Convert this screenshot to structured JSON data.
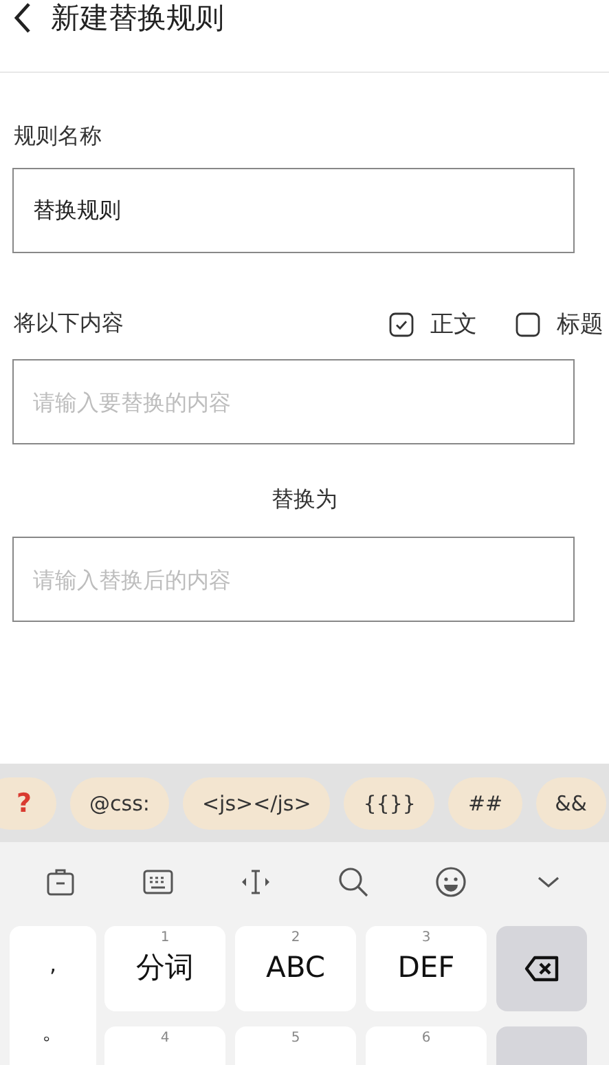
{
  "header": {
    "title": "新建替换规则"
  },
  "name_field": {
    "label": "规则名称",
    "value": "替换规则"
  },
  "find_section": {
    "label": "将以下内容",
    "options": [
      {
        "label": "正文",
        "checked": true
      },
      {
        "label": "标题",
        "checked": false
      }
    ],
    "placeholder": "请输入要替换的内容"
  },
  "replace_section": {
    "label": "替换为",
    "placeholder": "请输入替换后的内容"
  },
  "snippets": [
    {
      "text": "?",
      "kind": "help"
    },
    {
      "text": "@css:",
      "kind": "text"
    },
    {
      "text": "<js></js>",
      "kind": "text"
    },
    {
      "text": "{{}}",
      "kind": "text"
    },
    {
      "text": "##",
      "kind": "text"
    },
    {
      "text": "&&",
      "kind": "text"
    }
  ],
  "keyboard": {
    "punctuation": [
      ",",
      "。"
    ],
    "keys": [
      {
        "number": "1",
        "label": "分词",
        "kind": "key"
      },
      {
        "number": "2",
        "label": "ABC",
        "kind": "key"
      },
      {
        "number": "3",
        "label": "DEF",
        "kind": "key"
      },
      {
        "kind": "backspace"
      },
      {
        "number": "4",
        "kind": "key"
      },
      {
        "number": "5",
        "kind": "key"
      },
      {
        "number": "6",
        "kind": "key"
      },
      {
        "kind": "action"
      }
    ]
  }
}
